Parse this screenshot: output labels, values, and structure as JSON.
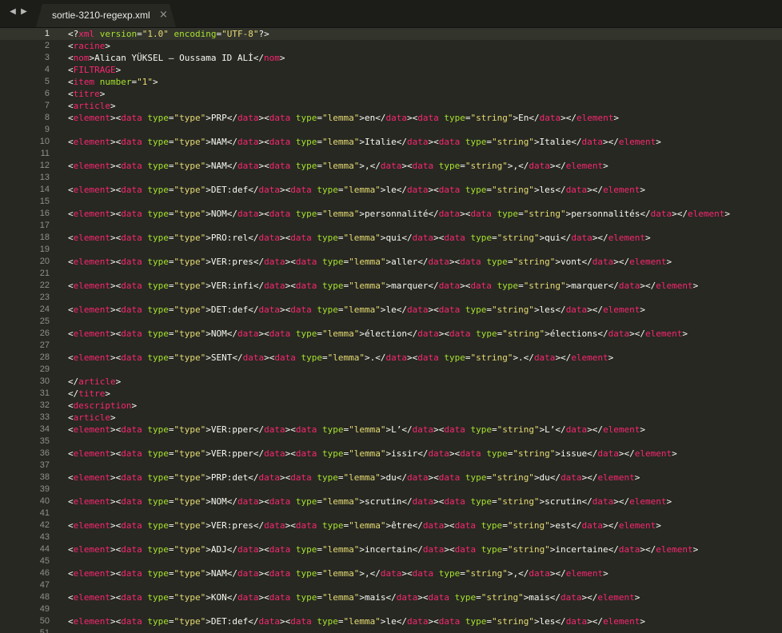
{
  "window": {
    "nav_back": "◀",
    "nav_forward": "▶",
    "tab": {
      "label": "sortie-3210-regexp.xml",
      "close": "×"
    }
  },
  "theme": {
    "background": "#272822",
    "text": "#f8f8f2",
    "tag": "#f92672",
    "attribute": "#a6e22e",
    "string": "#e6db74",
    "gutter": "#8f908a"
  },
  "editor": {
    "current_line": 1,
    "lines": [
      {
        "n": "1",
        "text": "<?xml version=\"1.0\" encoding=\"UTF-8\"?>"
      },
      {
        "n": "2",
        "text": "<racine>"
      },
      {
        "n": "3",
        "text": "<nom>Alican YÜKSEL – Oussama ID ALİ</nom>"
      },
      {
        "n": "4",
        "text": "<FILTRAGE>"
      },
      {
        "n": "5",
        "text": "<item number=\"1\">"
      },
      {
        "n": "6",
        "text": "<titre>"
      },
      {
        "n": "7",
        "text": "<article>"
      },
      {
        "n": "8",
        "text": "<element><data type=\"type\">PRP</data><data type=\"lemma\">en</data><data type=\"string\">En</data></element>"
      },
      {
        "n": "9",
        "text": ""
      },
      {
        "n": "10",
        "text": "<element><data type=\"type\">NAM</data><data type=\"lemma\">Italie</data><data type=\"string\">Italie</data></element>"
      },
      {
        "n": "11",
        "text": ""
      },
      {
        "n": "12",
        "text": "<element><data type=\"type\">NAM</data><data type=\"lemma\">,</data><data type=\"string\">,</data></element>"
      },
      {
        "n": "13",
        "text": ""
      },
      {
        "n": "14",
        "text": "<element><data type=\"type\">DET:def</data><data type=\"lemma\">le</data><data type=\"string\">les</data></element>"
      },
      {
        "n": "15",
        "text": ""
      },
      {
        "n": "16",
        "text": "<element><data type=\"type\">NOM</data><data type=\"lemma\">personnalité</data><data type=\"string\">personnalités</data></element>"
      },
      {
        "n": "17",
        "text": ""
      },
      {
        "n": "18",
        "text": "<element><data type=\"type\">PRO:rel</data><data type=\"lemma\">qui</data><data type=\"string\">qui</data></element>"
      },
      {
        "n": "19",
        "text": ""
      },
      {
        "n": "20",
        "text": "<element><data type=\"type\">VER:pres</data><data type=\"lemma\">aller</data><data type=\"string\">vont</data></element>"
      },
      {
        "n": "21",
        "text": ""
      },
      {
        "n": "22",
        "text": "<element><data type=\"type\">VER:infi</data><data type=\"lemma\">marquer</data><data type=\"string\">marquer</data></element>"
      },
      {
        "n": "23",
        "text": ""
      },
      {
        "n": "24",
        "text": "<element><data type=\"type\">DET:def</data><data type=\"lemma\">le</data><data type=\"string\">les</data></element>"
      },
      {
        "n": "25",
        "text": ""
      },
      {
        "n": "26",
        "text": "<element><data type=\"type\">NOM</data><data type=\"lemma\">élection</data><data type=\"string\">élections</data></element>"
      },
      {
        "n": "27",
        "text": ""
      },
      {
        "n": "28",
        "text": "<element><data type=\"type\">SENT</data><data type=\"lemma\">.</data><data type=\"string\">.</data></element>"
      },
      {
        "n": "29",
        "text": ""
      },
      {
        "n": "30",
        "text": "</article>"
      },
      {
        "n": "31",
        "text": "</titre>"
      },
      {
        "n": "32",
        "text": "<description>"
      },
      {
        "n": "33",
        "text": "<article>"
      },
      {
        "n": "34",
        "text": "<element><data type=\"type\">VER:pper</data><data type=\"lemma\">L’</data><data type=\"string\">L’</data></element>"
      },
      {
        "n": "35",
        "text": ""
      },
      {
        "n": "36",
        "text": "<element><data type=\"type\">VER:pper</data><data type=\"lemma\">issir</data><data type=\"string\">issue</data></element>"
      },
      {
        "n": "37",
        "text": ""
      },
      {
        "n": "38",
        "text": "<element><data type=\"type\">PRP:det</data><data type=\"lemma\">du</data><data type=\"string\">du</data></element>"
      },
      {
        "n": "39",
        "text": ""
      },
      {
        "n": "40",
        "text": "<element><data type=\"type\">NOM</data><data type=\"lemma\">scrutin</data><data type=\"string\">scrutin</data></element>"
      },
      {
        "n": "41",
        "text": ""
      },
      {
        "n": "42",
        "text": "<element><data type=\"type\">VER:pres</data><data type=\"lemma\">être</data><data type=\"string\">est</data></element>"
      },
      {
        "n": "43",
        "text": ""
      },
      {
        "n": "44",
        "text": "<element><data type=\"type\">ADJ</data><data type=\"lemma\">incertain</data><data type=\"string\">incertaine</data></element>"
      },
      {
        "n": "45",
        "text": ""
      },
      {
        "n": "46",
        "text": "<element><data type=\"type\">NAM</data><data type=\"lemma\">,</data><data type=\"string\">,</data></element>"
      },
      {
        "n": "47",
        "text": ""
      },
      {
        "n": "48",
        "text": "<element><data type=\"type\">KON</data><data type=\"lemma\">mais</data><data type=\"string\">mais</data></element>"
      },
      {
        "n": "49",
        "text": ""
      },
      {
        "n": "50",
        "text": "<element><data type=\"type\">DET:def</data><data type=\"lemma\">le</data><data type=\"string\">les</data></element>"
      },
      {
        "n": "51",
        "text": ""
      }
    ]
  }
}
